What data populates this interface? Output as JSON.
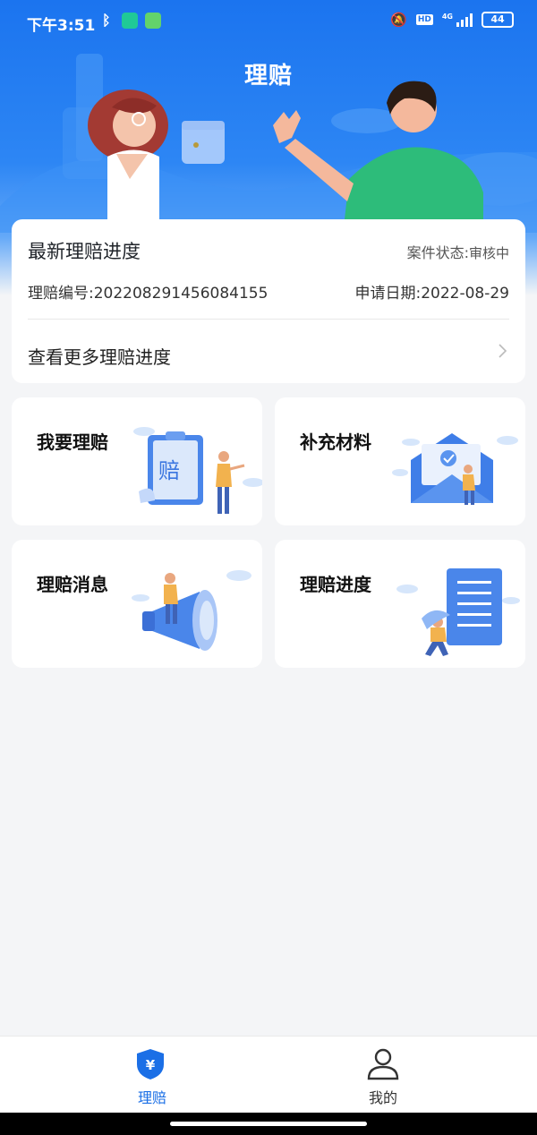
{
  "status_bar": {
    "time": "下午3:51",
    "hd": "HD",
    "network": "4G",
    "battery": "44"
  },
  "header": {
    "title": "理赔"
  },
  "progress_card": {
    "title": "最新理赔进度",
    "status_label": "案件状态:",
    "status_value": "审核中",
    "claim_number": "理赔编号:2022082914560841​55",
    "apply_date": "申请日期:2022-08-29",
    "more_link": "查看更多理赔进度"
  },
  "tiles": [
    {
      "label": "我要理赔",
      "icon": "claim-form-icon"
    },
    {
      "label": "补充材料",
      "icon": "envelope-document-icon"
    },
    {
      "label": "理赔消息",
      "icon": "megaphone-icon"
    },
    {
      "label": "理赔进度",
      "icon": "progress-list-icon"
    }
  ],
  "tab_bar": {
    "items": [
      {
        "label": "理赔",
        "icon": "shield-yen-icon",
        "active": true
      },
      {
        "label": "我的",
        "icon": "user-icon",
        "active": false
      }
    ]
  },
  "colors": {
    "accent": "#1b6fe6",
    "hero_top": "#1b74ef"
  }
}
